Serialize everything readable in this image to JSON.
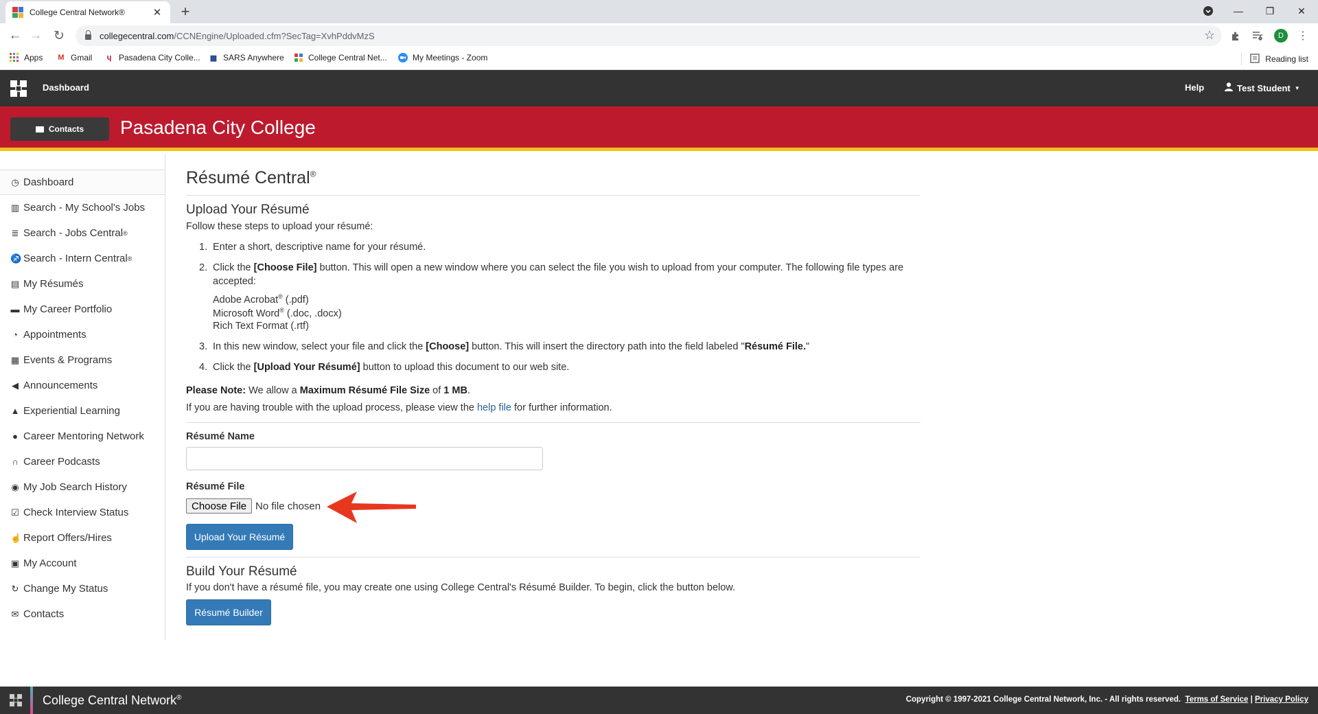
{
  "browser": {
    "tab_title": "College Central Network®",
    "url_host": "collegecentral.com",
    "url_path": "/CCNEngine/Uploaded.cfm?SecTag=XvhPddvMzS",
    "profile_initial": "D",
    "bookmarks": [
      "Apps",
      "Gmail",
      "Pasadena City Colle...",
      "SARS Anywhere",
      "College Central Net...",
      "My Meetings - Zoom"
    ],
    "reading_list": "Reading list"
  },
  "topnav": {
    "dashboard": "Dashboard",
    "help": "Help",
    "user": "Test Student"
  },
  "banner": {
    "contacts_button": "Contacts",
    "college_name": "Pasadena City College",
    "color": "#bd1a2e",
    "accent": "#f2c21a"
  },
  "sidebar": {
    "items": [
      {
        "label": "Dashboard",
        "icon": "dashboard-icon"
      },
      {
        "label": "Search - My School's Jobs",
        "icon": "institution-icon"
      },
      {
        "label": "Search - Jobs Central",
        "sup": "®",
        "icon": "list-icon"
      },
      {
        "label": "Search - Intern Central",
        "sup": "®",
        "icon": "intern-icon"
      },
      {
        "label": "My Résumés",
        "icon": "document-icon"
      },
      {
        "label": "My Career Portfolio",
        "icon": "briefcase-icon"
      },
      {
        "label": "Appointments",
        "icon": "clock-icon"
      },
      {
        "label": "Events & Programs",
        "icon": "calendar-icon"
      },
      {
        "label": "Announcements",
        "icon": "bullhorn-icon"
      },
      {
        "label": "Experiential Learning",
        "icon": "graduation-cap-icon"
      },
      {
        "label": "Career Mentoring Network",
        "icon": "user-icon"
      },
      {
        "label": "Career Podcasts",
        "icon": "headphones-icon"
      },
      {
        "label": "My Job Search History",
        "icon": "eye-icon"
      },
      {
        "label": "Check Interview Status",
        "icon": "check-square-icon"
      },
      {
        "label": "Report Offers/Hires",
        "icon": "thumbs-up-icon"
      },
      {
        "label": "My Account",
        "icon": "account-icon"
      },
      {
        "label": "Change My Status",
        "icon": "refresh-icon"
      },
      {
        "label": "Contacts",
        "icon": "envelope-icon"
      }
    ]
  },
  "main": {
    "title": "Résumé Central",
    "title_sup": "®",
    "upload_heading": "Upload Your Résumé",
    "intro": "Follow these steps to upload your résumé:",
    "step1": "Enter a short, descriptive name for your résumé.",
    "step2_a": "Click the ",
    "step2_b": "[Choose File]",
    "step2_c": " button. This will open a new window where you can select the file you wish to upload from your computer. The following file types are",
    "step2_d": "accepted:",
    "ft1_a": "Adobe Acrobat",
    "ft1_b": " (.pdf)",
    "ft2_a": "Microsoft Word",
    "ft2_b": " (.doc, .docx)",
    "ft3": "Rich Text Format (.rtf)",
    "reg": "®",
    "step3_a": "In this new window, select your file and click the ",
    "step3_b": "[Choose]",
    "step3_c": " button. This will insert the directory path into the field labeled \"",
    "step3_d": "Résumé File.",
    "step3_e": "\"",
    "step4_a": "Click the ",
    "step4_b": "[Upload Your Résumé]",
    "step4_c": " button to upload this document to our web site.",
    "note_a": "Please Note:",
    "note_b": " We allow a ",
    "note_c": "Maximum Résumé File Size",
    "note_d": " of ",
    "note_e": "1 MB",
    "note_f": ".",
    "trouble_a": "If you are having trouble with the upload process, please view the ",
    "trouble_link": "help file",
    "trouble_b": " for further information.",
    "name_label": "Résumé Name",
    "name_value": "",
    "file_label": "Résumé File",
    "choose_file": "Choose File",
    "no_file": "No file chosen",
    "upload_button": "Upload Your Résumé",
    "build_heading": "Build Your Résumé",
    "build_text": "If you don't have a résumé file, you may create one using College Central's Résumé Builder. To begin, click the button below.",
    "builder_button": "Résumé Builder"
  },
  "footer": {
    "brand": "College Central Network",
    "brand_sup": "®",
    "copyright": "Copyright © 1997-2021 College Central Network, Inc. - All rights reserved.",
    "terms": "Terms of Service",
    "divider": "|",
    "privacy": "Privacy Policy"
  }
}
